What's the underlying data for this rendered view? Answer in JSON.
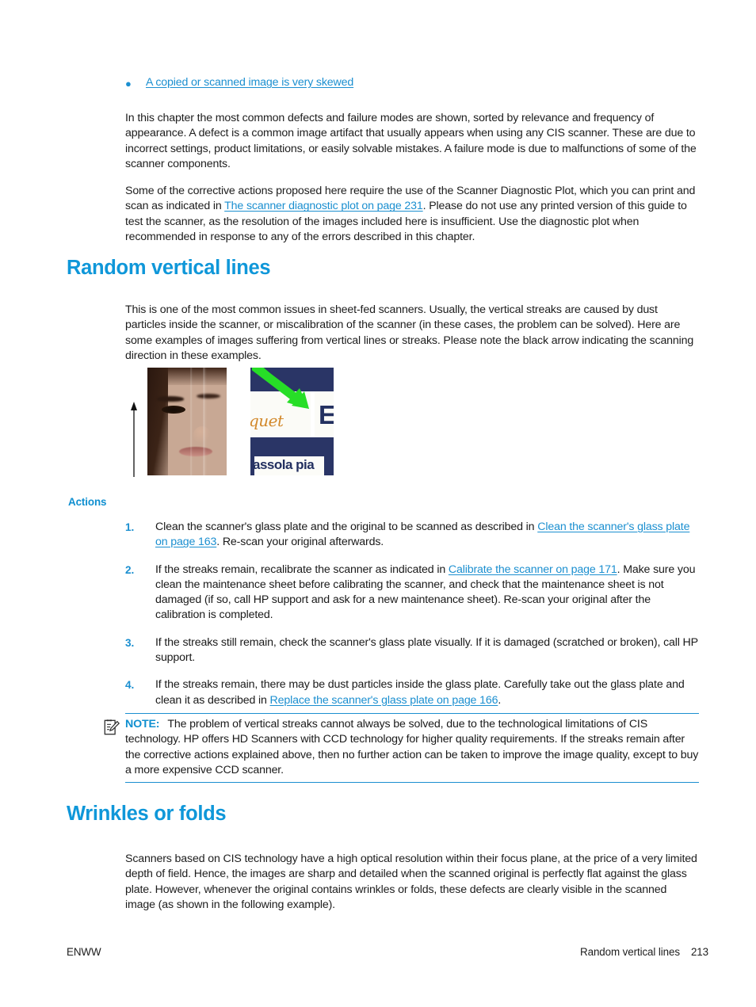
{
  "bullet": {
    "marker": "●",
    "link_text": "A copied or scanned image is very skewed"
  },
  "paragraphs": {
    "intro": "In this chapter the most common defects and failure modes are shown, sorted by relevance and frequency of appearance. A defect is a common image artifact that usually appears when using any CIS scanner. These are due to incorrect settings, product limitations, or easily solvable mistakes. A failure mode is due to malfunctions of some of the scanner components.",
    "corrective_pre": "Some of the corrective actions proposed here require the use of the Scanner Diagnostic Plot, which you can print and scan as indicated in ",
    "corrective_link": "The scanner diagnostic plot on page 231",
    "corrective_post": ". Please do not use any printed version of this guide to test the scanner, as the resolution of the images included here is insufficient. Use the diagnostic plot when recommended in response to any of the errors described in this chapter.",
    "random_vertical_lines": "This is one of the most common issues in sheet-fed scanners. Usually, the vertical streaks are caused by dust particles inside the scanner, or miscalibration of the scanner (in these cases, the problem can be solved). Here are some examples of images suffering from vertical lines or streaks. Please note the black arrow indicating the scanning direction in these examples.",
    "wrinkles": "Scanners based on CIS technology have a high optical resolution within their focus plane, at the price of a very limited depth of field. Hence, the images are sharp and detailed when the scanned original is perfectly flat against the glass plate. However, whenever the original contains wrinkles or folds, these defects are clearly visible in the scanned image (as shown in the following example)."
  },
  "headings": {
    "random_vertical_lines": "Random vertical lines",
    "wrinkles_or_folds": "Wrinkles or folds",
    "actions": "Actions"
  },
  "figure": {
    "scan_direction_arrow": "up-arrow",
    "portrait_alt": "scanned portrait with vertical streaks",
    "sign": {
      "script_text": "quet",
      "big_letter": "E",
      "bottom_text": "assola pia",
      "arrow": "green-arrow"
    }
  },
  "actions": [
    {
      "number": "1.",
      "pre": "Clean the scanner's glass plate and the original to be scanned as described in ",
      "link": "Clean the scanner's glass plate on page 163",
      "post": ". Re-scan your original afterwards."
    },
    {
      "number": "2.",
      "pre": "If the streaks remain, recalibrate the scanner as indicated in ",
      "link": "Calibrate the scanner on page 171",
      "post": ". Make sure you clean the maintenance sheet before calibrating the scanner, and check that the maintenance sheet is not damaged (if so, call HP support and ask for a new maintenance sheet). Re-scan your original after the calibration is completed."
    },
    {
      "number": "3.",
      "pre": "If the streaks still remain, check the scanner's glass plate visually. If it is damaged (scratched or broken), call HP support.",
      "link": "",
      "post": ""
    },
    {
      "number": "4.",
      "pre": "If the streaks remain, there may be dust particles inside the glass plate. Carefully take out the glass plate and clean it as described in ",
      "link": "Replace the scanner's glass plate on page 166",
      "post": "."
    }
  ],
  "note": {
    "icon": "note-clipboard-icon",
    "label": "NOTE:",
    "text": "The problem of vertical streaks cannot always be solved, due to the technological limitations of CIS technology. HP offers HD Scanners with CCD technology for higher quality requirements. If the streaks remain after the corrective actions explained above, then no further action can be taken to improve the image quality, except to buy a more expensive CCD scanner."
  },
  "footer": {
    "left": "ENWW",
    "section": "Random vertical lines",
    "page_number": "213"
  },
  "colors": {
    "heading_blue": "#0f97d9",
    "link_blue": "#1b8fd0",
    "body_text": "#1d1d1d",
    "note_rule": "#1b8fd0",
    "arrow_green": "#27de27",
    "sign_navy": "#2a3566",
    "sign_orange": "#d2892c"
  }
}
